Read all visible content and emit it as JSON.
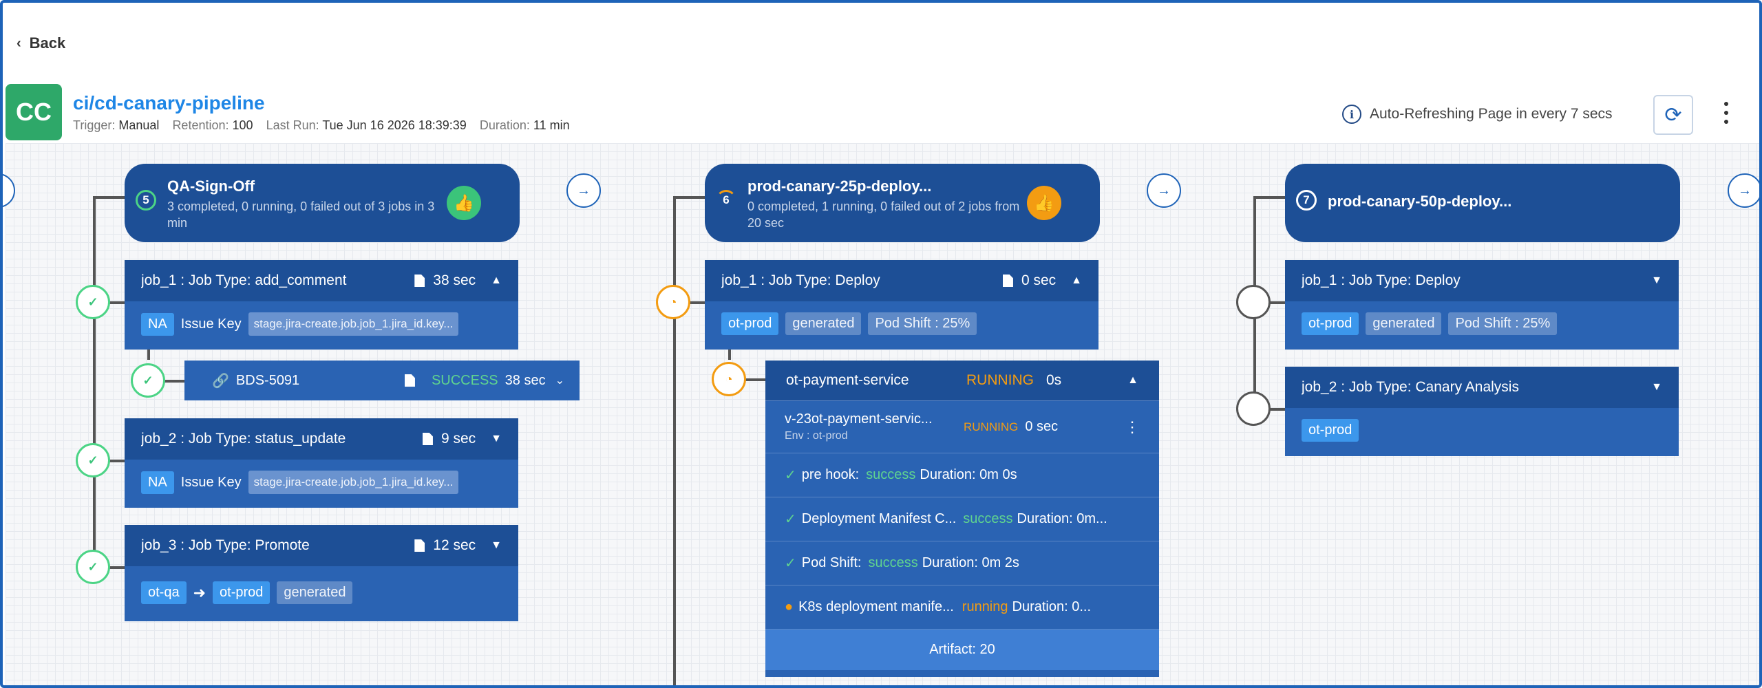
{
  "back_label": "Back",
  "pipeline": {
    "avatar": "CC",
    "name": "ci/cd-canary-pipeline",
    "trigger_label": "Trigger:",
    "trigger": "Manual",
    "retention_label": "Retention:",
    "retention": "100",
    "last_run_label": "Last Run:",
    "last_run": "Tue Jun 16 2026 18:39:39",
    "duration_label": "Duration:",
    "duration": "11 min"
  },
  "auto_refresh": "Auto-Refreshing Page in every 7 secs",
  "stages": [
    {
      "number": "5",
      "name": "QA-Sign-Off",
      "status": "3 completed, 0 running, 0 failed out of 3 jobs in 3 min",
      "jobs": [
        {
          "name": "job_1 : Job Type: add_comment",
          "duration": "38 sec",
          "tag1": "NA",
          "label": "Issue Key",
          "key": "stage.jira-create.job.job_1.jira_id.key..."
        },
        {
          "name": "job_2 : Job Type: status_update",
          "duration": "9 sec",
          "tag1": "NA",
          "label": "Issue Key",
          "key": "stage.jira-create.job.job_1.jira_id.key..."
        },
        {
          "name": "job_3 : Job Type: Promote",
          "duration": "12 sec",
          "from": "ot-qa",
          "to": "ot-prod",
          "tag": "generated"
        }
      ],
      "sub": {
        "ticket": "BDS-5091",
        "status": "SUCCESS",
        "duration": "38 sec"
      }
    },
    {
      "number": "6",
      "name": "prod-canary-25p-deploy...",
      "status": "0 completed, 1 running, 0 failed out of 2 jobs from 20 sec",
      "jobs": [
        {
          "name": "job_1 : Job Type: Deploy",
          "duration": "0 sec",
          "tags": [
            "ot-prod",
            "generated",
            "Pod Shift : 25%"
          ]
        }
      ],
      "service": {
        "name": "ot-payment-service",
        "status": "RUNNING",
        "elapsed": "0s",
        "version": "v-23ot-payment-servic...",
        "env": "Env : ot-prod",
        "version_status": "RUNNING",
        "version_elapsed": "0 sec",
        "steps": [
          {
            "name": "pre hook:",
            "status": "success",
            "duration": "Duration: 0m 0s"
          },
          {
            "name": "Deployment Manifest C...",
            "status": "success",
            "duration": "Duration: 0m..."
          },
          {
            "name": "Pod Shift:",
            "status": "success",
            "duration": "Duration: 0m 2s"
          },
          {
            "name": "K8s deployment manife...",
            "status": "running",
            "duration": "Duration: 0..."
          }
        ],
        "artifact": "Artifact: 20"
      }
    },
    {
      "number": "7",
      "name": "prod-canary-50p-deploy...",
      "jobs": [
        {
          "name": "job_1 : Job Type: Deploy",
          "tags": [
            "ot-prod",
            "generated",
            "Pod Shift : 25%"
          ]
        },
        {
          "name": "job_2 : Job Type: Canary Analysis",
          "tags": [
            "ot-prod"
          ]
        }
      ]
    }
  ],
  "icons": {
    "back": "chevron-left-icon",
    "refresh": "refresh-icon",
    "more": "kebab-menu-icon",
    "info": "info-icon",
    "thumb": "thumbs-up-icon",
    "arrow": "arrow-right-icon",
    "check": "check-icon",
    "clock": "clock-icon",
    "link": "link-icon",
    "doc": "document-icon"
  },
  "colors": {
    "primary": "#1d4f96",
    "job_body": "#2a63b3",
    "success": "#3bc47a",
    "running": "#f39c12",
    "link": "#1e86e6",
    "avatar_bg": "#2ea869"
  }
}
